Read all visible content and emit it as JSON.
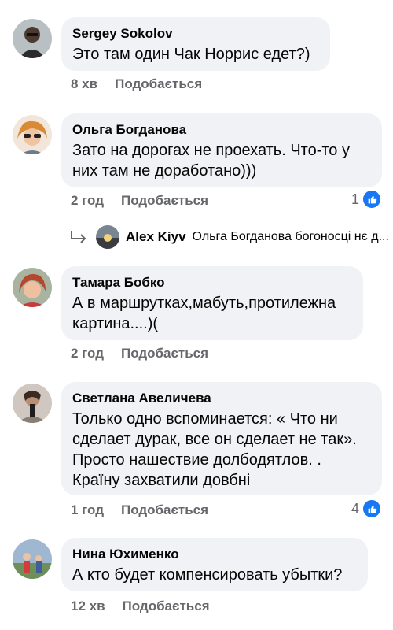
{
  "comments": [
    {
      "author": "Sergey Sokolov",
      "lines": [
        "Это там один Чак Норрис едет?)"
      ],
      "time": "8 хв",
      "like_label": "Подобається",
      "reactions": ""
    },
    {
      "author": "Ольга Богданова",
      "lines": [
        "Зато на дорогах не проехать. Что-то у",
        "них там не доработано)))"
      ],
      "time": "2 год",
      "like_label": "Подобається",
      "reactions": "1"
    },
    {
      "author": "Тамара Бобко",
      "lines": [
        "А в маршрутках,мабуть,протилежна",
        "картина....)("
      ],
      "time": "2 год",
      "like_label": "Подобається",
      "reactions": ""
    },
    {
      "author": "Светлана Авеличева",
      "lines": [
        "Только одно вспоминается: « Что ни",
        "сделает дурак, все он сделает не так».",
        "Просто нашествие долбодятлов. .",
        "Країну захватили довбні"
      ],
      "time": "1 год",
      "like_label": "Подобається",
      "reactions": "4"
    },
    {
      "author": "Нина Юхименко",
      "lines": [
        "А кто будет компенсировать убытки?"
      ],
      "time": "12 хв",
      "like_label": "Подобається",
      "reactions": ""
    }
  ],
  "reply_preview": {
    "author": "Alex Kiyv",
    "text": "Ольга Богданова богоносці нє д..."
  },
  "colors": {
    "bubble": "#f0f2f5",
    "meta_text": "#65676b",
    "like_blue": "#1877f2"
  }
}
